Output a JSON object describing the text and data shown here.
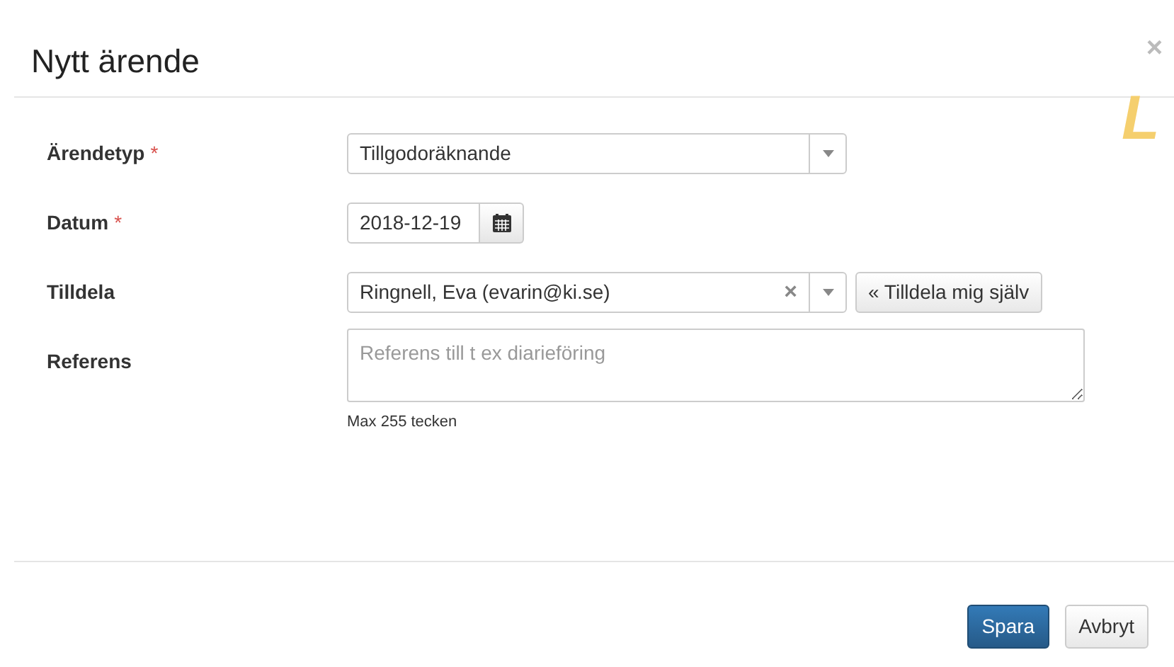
{
  "dialog": {
    "title": "Nytt ärende",
    "close": "×"
  },
  "background_text": "L",
  "fields": [
    {
      "kind": "select",
      "label": "Ärendetyp",
      "required_mark": "*",
      "value": "Tillgodoräknande"
    },
    {
      "kind": "date",
      "label": "Datum",
      "required_mark": "*",
      "value": "2018-12-19"
    },
    {
      "kind": "select",
      "label": "Tilldela",
      "value": "Ringnell, Eva (evarin@ki.se)",
      "clear": "×",
      "action": "« Tilldela mig själv"
    },
    {
      "kind": "textarea",
      "label": "Referens",
      "placeholder": "Referens till t ex diarieföring",
      "help": "Max 255 tecken"
    }
  ],
  "buttons": [
    {
      "label": "Spara",
      "primary": true
    },
    {
      "label": "Avbryt",
      "primary": false
    }
  ]
}
